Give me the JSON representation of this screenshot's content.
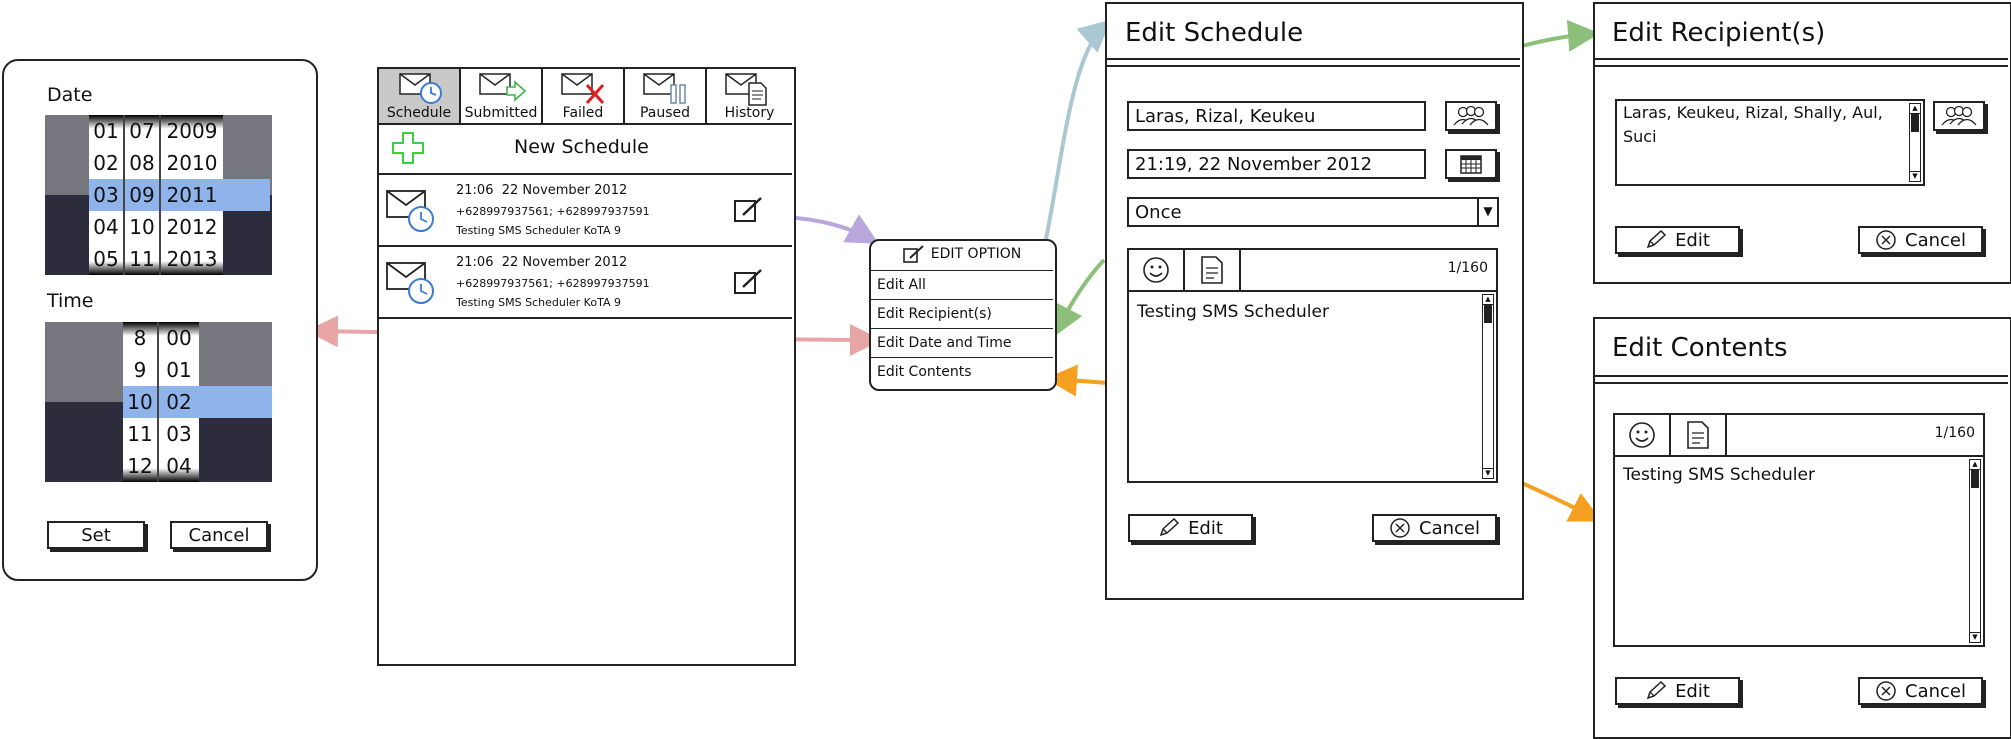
{
  "date_time_picker": {
    "date_label": "Date",
    "time_label": "Time",
    "day_col": [
      "01",
      "02",
      "03",
      "04",
      "05"
    ],
    "month_col": [
      "07",
      "08",
      "09",
      "10",
      "11"
    ],
    "year_col": [
      "2009",
      "2010",
      "2011",
      "2012",
      "2013"
    ],
    "hour_col": [
      "8",
      "9",
      "10",
      "11",
      "12"
    ],
    "minute_col": [
      "00",
      "01",
      "02",
      "03",
      "04"
    ],
    "set_label": "Set",
    "cancel_label": "Cancel"
  },
  "main_screen": {
    "tabs": [
      {
        "label": "Schedule"
      },
      {
        "label": "Submitted"
      },
      {
        "label": "Failed"
      },
      {
        "label": "Paused"
      },
      {
        "label": "History"
      }
    ],
    "new_schedule_label": "New Schedule",
    "messages": [
      {
        "datetime": "21:06  22 November 2012",
        "recipients": "+628997937561; +628997937591",
        "text": "Testing SMS Scheduler KoTA 9"
      },
      {
        "datetime": "21:06  22 November 2012",
        "recipients": "+628997937561; +628997937591",
        "text": "Testing SMS Scheduler KoTA 9"
      }
    ]
  },
  "edit_option_menu": {
    "title": "EDIT OPTION",
    "items": [
      "Edit All",
      "Edit Recipient(s)",
      "Edit Date and Time",
      "Edit Contents"
    ]
  },
  "edit_schedule": {
    "title": "Edit Schedule",
    "recipients_value": "Laras, Rizal, Keukeu",
    "datetime_value": "21:19, 22 November 2012",
    "repeat_value": "Once",
    "char_count": "1/160",
    "message_text": "Testing SMS Scheduler",
    "edit_label": "Edit",
    "cancel_label": "Cancel"
  },
  "edit_recipients": {
    "title": "Edit Recipient(s)",
    "recipients_line1": "Laras, Keukeu, Rizal, Shally, Aul,",
    "recipients_line2": "Suci",
    "edit_label": "Edit",
    "cancel_label": "Cancel"
  },
  "edit_contents": {
    "title": "Edit Contents",
    "char_count": "1/160",
    "message_text": "Testing SMS Scheduler",
    "edit_label": "Edit",
    "cancel_label": "Cancel"
  },
  "colors": {
    "purple_arrow": "#b9a7dc",
    "blue_arrow": "#a9c8d2",
    "green_arrow": "#8cc07a",
    "red_arrow": "#e8a5a5",
    "orange_arrow": "#f5a020",
    "picker_highlight": "#8fb4ec",
    "picker_dark": "#2c2c3c",
    "picker_mid": "#76767f"
  }
}
